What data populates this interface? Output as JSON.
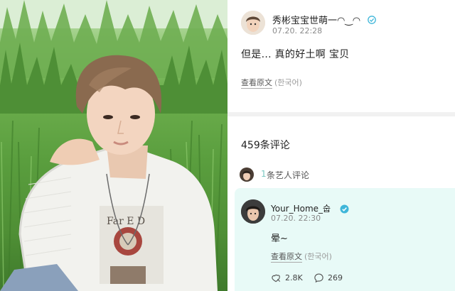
{
  "post": {
    "author": "秀彬宝宝世萌一◠‿◠",
    "time": "07.20. 22:28",
    "text": "但是... 真的好土啊 宝贝",
    "view_original": "查看原文",
    "original_lang": "(한국어)"
  },
  "comments_summary": {
    "count_label": "459条评论",
    "artist_count": "1",
    "artist_label": "条艺人评论"
  },
  "comment": {
    "author": "Your_Home_숩",
    "time": "07.20. 22:30",
    "text": "晕~",
    "view_original": "查看原文",
    "original_lang": "(한국어)",
    "likes": "2.8K",
    "replies": "269"
  },
  "icons": {
    "verified": "verified-badge-icon",
    "like": "like-icon",
    "reply": "comment-bubble-icon"
  },
  "colors": {
    "accent": "#7bc8c2",
    "comment_card_bg": "#e8faf7",
    "verified": "#3fb6d9"
  }
}
